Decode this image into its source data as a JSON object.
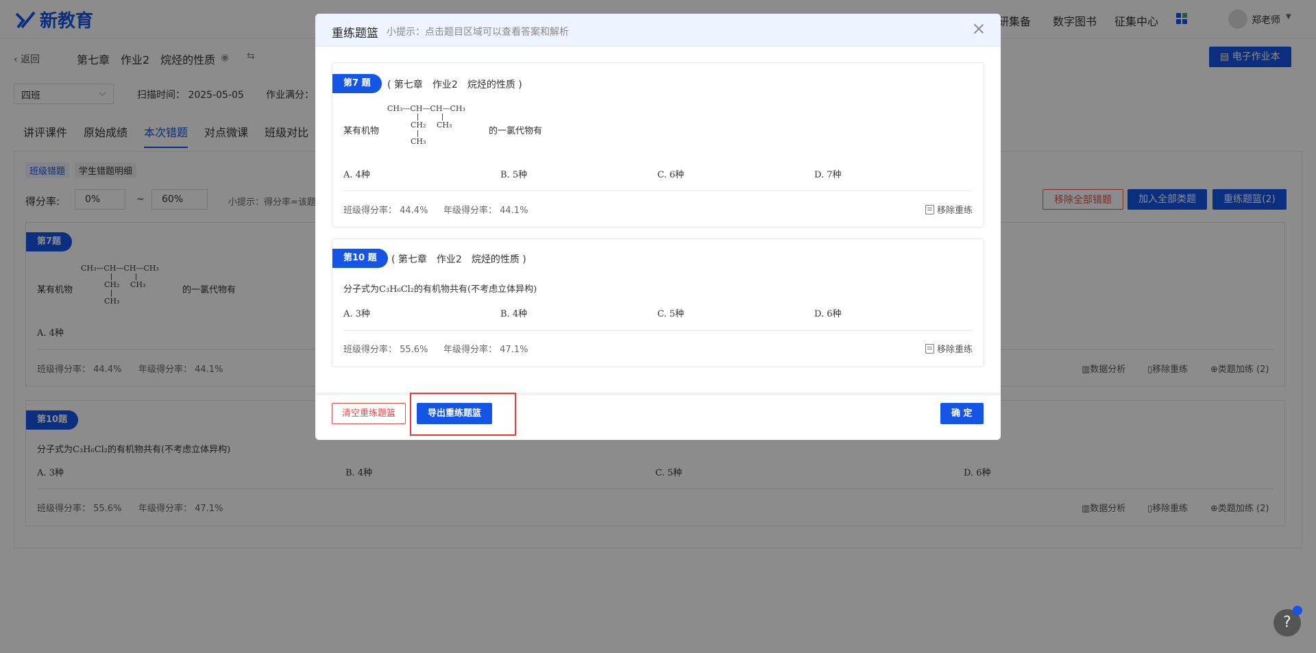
{
  "app": {
    "logo_text": "新教育"
  },
  "topnav": {
    "items": [
      "教研集备",
      "数字图书",
      "征集中心"
    ],
    "user": "郑老师"
  },
  "subhead": {
    "back": "返回",
    "breadcrumb": "第七章　作业2　烷烃的性质",
    "class_select": "四班",
    "scan_time": "扫描时间： 2025-05-05",
    "full_score_label": "作业满分：",
    "ebook_button": "电子作业本"
  },
  "tabs": [
    "讲评课件",
    "原始成绩",
    "本次错题",
    "对点微课",
    "班级对比"
  ],
  "subtabs": [
    "班级错题",
    "学生错题明细"
  ],
  "filter": {
    "label": "得分率:",
    "from": "0%",
    "tilde": "~",
    "to": "60%",
    "hint": "小提示：得分率=该题",
    "remove_all": "移除全部错题",
    "add_all": "加入全部类题",
    "basket": "重练题篮(2)"
  },
  "bg_questions": [
    {
      "tag": "第7题",
      "stem_prefix": "某有机物",
      "stem_suffix": "的一氯代物有",
      "options": [
        "A. 4种"
      ],
      "class_rate": "班级得分率： 44.4%",
      "grade_rate": "年级得分率： 44.1%",
      "actions": [
        "数据分析",
        "移除重练",
        "类题加练 (2)"
      ]
    },
    {
      "tag": "第10题",
      "stem": "分子式为C₃H₆Cl₂的有机物共有(不考虑立体异构)",
      "options": [
        "A. 3种",
        "B. 4种",
        "C. 5种",
        "D. 6种"
      ],
      "class_rate": "班级得分率： 55.6%",
      "grade_rate": "年级得分率： 47.1%",
      "actions": [
        "数据分析",
        "移除重练",
        "类题加练 (2)"
      ]
    }
  ],
  "modal": {
    "title": "重练题篮",
    "hint": "小提示：点击题目区域可以查看答案和解析",
    "questions": [
      {
        "tag": "第7 题",
        "chapter": "( 第七章　作业2　烷烃的性质 )",
        "stem_prefix": "某有机物",
        "stem_suffix": "的一氯代物有",
        "options": [
          "A. 4种",
          "B. 5种",
          "C. 6种",
          "D. 7种"
        ],
        "class_rate": "班级得分率： 44.4%",
        "grade_rate": "年级得分率： 44.1%",
        "remove": "移除重练"
      },
      {
        "tag": "第10 题",
        "chapter": "( 第七章　作业2　烷烃的性质 )",
        "stem": "分子式为C₃H₆Cl₂的有机物共有(不考虑立体异构)",
        "options": [
          "A. 3种",
          "B. 4种",
          "C. 5种",
          "D. 6种"
        ],
        "class_rate": "班级得分率： 55.6%",
        "grade_rate": "年级得分率： 47.1%",
        "remove": "移除重练"
      }
    ],
    "clear_button": "清空重练题篮",
    "export_button": "导出重练题篮",
    "confirm_button": "确 定"
  },
  "molecule": {
    "top": "CH₃—CH—CH—CH₃",
    "mid1": "CH₂",
    "mid2": "CH₃",
    "bottom": "CH₃"
  },
  "help": {
    "label": "?"
  },
  "colors": {
    "brand": "#1455e5",
    "danger": "#e34d4d",
    "highlight": "#e53935"
  }
}
